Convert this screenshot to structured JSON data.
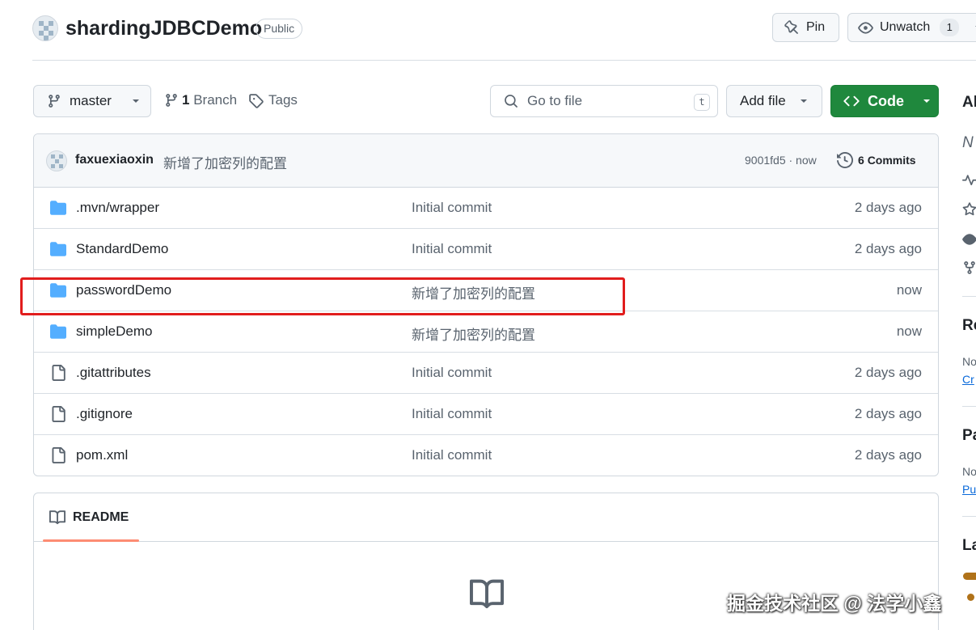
{
  "repo": {
    "name": "shardingJDBCDemo",
    "visibility": "Public",
    "pin_label": "Pin",
    "watch_label": "Unwatch",
    "watch_count": "1"
  },
  "toolbar": {
    "branch": "master",
    "branch_count": "1",
    "branch_label": "Branch",
    "tags_label": "Tags",
    "search_placeholder": "Go to file",
    "search_shortcut": "t",
    "add_file_label": "Add file",
    "code_label": "Code"
  },
  "latest_commit": {
    "author": "faxuexiaoxin",
    "message": "新增了加密列的配置",
    "hash": "9001fd5 · now",
    "commits_count": "6",
    "commits_label": "Commits"
  },
  "files": [
    {
      "type": "folder",
      "name": ".mvn/wrapper",
      "commit": "Initial commit",
      "time": "2 days ago"
    },
    {
      "type": "folder",
      "name": "StandardDemo",
      "commit": "Initial commit",
      "time": "2 days ago"
    },
    {
      "type": "folder",
      "name": "passwordDemo",
      "commit": "新增了加密列的配置",
      "time": "now"
    },
    {
      "type": "folder",
      "name": "simpleDemo",
      "commit": "新增了加密列的配置",
      "time": "now"
    },
    {
      "type": "file",
      "name": ".gitattributes",
      "commit": "Initial commit",
      "time": "2 days ago"
    },
    {
      "type": "file",
      "name": ".gitignore",
      "commit": "Initial commit",
      "time": "2 days ago"
    },
    {
      "type": "file",
      "name": "pom.xml",
      "commit": "Initial commit",
      "time": "2 days ago"
    }
  ],
  "readme": {
    "tab_label": "README"
  },
  "sidebar": {
    "about_heading": "Al",
    "no_description": "N",
    "readme_heading": "Re",
    "readme_note": "No",
    "readme_link": "Cr",
    "packages_heading": "Pa",
    "packages_note": "No",
    "packages_link": "Pu",
    "languages_heading": "La"
  },
  "watermark": "掘金技术社区 @ 法学小鑫",
  "colors": {
    "accent_green": "#1f883d",
    "folder_blue": "#54aeff",
    "highlight_red": "#e11d1d",
    "language_java": "#b07219"
  }
}
